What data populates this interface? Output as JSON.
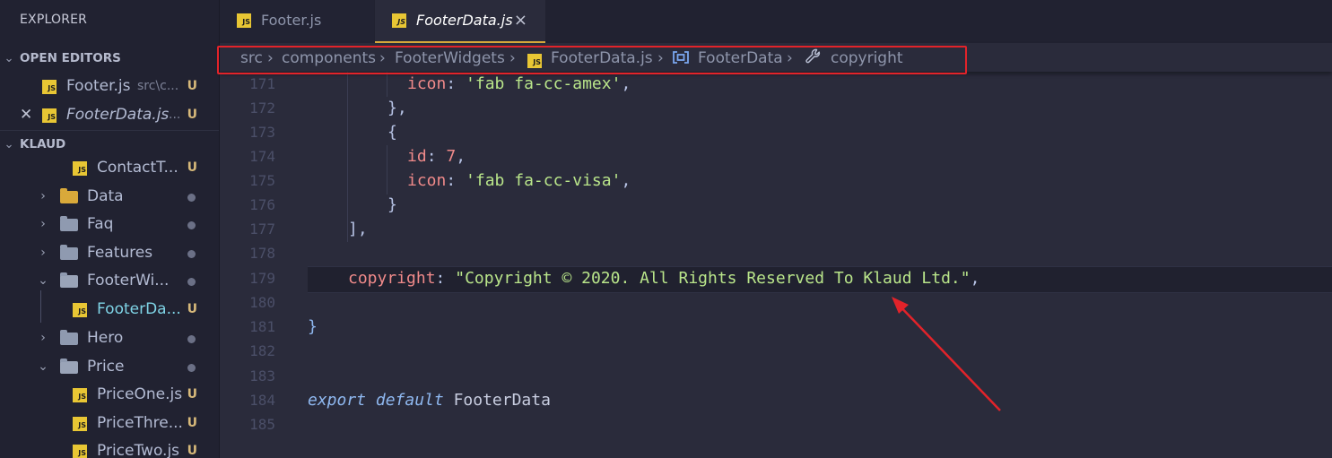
{
  "sidebar": {
    "title": "EXPLORER",
    "open_editors_label": "OPEN EDITORS",
    "open_editors": [
      {
        "icon": "js-file-icon",
        "name": "Footer.js",
        "path": "src\\c...",
        "badge": "U",
        "active": false
      },
      {
        "icon": "js-file-icon",
        "name": "FooterData.js",
        "path": "...",
        "badge": "U",
        "active": true
      }
    ],
    "project_label": "KLAUD",
    "tree": [
      {
        "type": "file",
        "name": "ContactT...",
        "badge": "U"
      },
      {
        "type": "folder",
        "name": "Data",
        "expanded": false
      },
      {
        "type": "folder",
        "name": "Faq",
        "expanded": false
      },
      {
        "type": "folder",
        "name": "Features",
        "expanded": false
      },
      {
        "type": "folder",
        "name": "FooterWi...",
        "expanded": true
      },
      {
        "type": "file",
        "name": "FooterDa...",
        "badge": "U",
        "selected": true
      },
      {
        "type": "folder",
        "name": "Hero",
        "expanded": false
      },
      {
        "type": "folder",
        "name": "Price",
        "expanded": true
      },
      {
        "type": "file",
        "name": "PriceOne.js",
        "badge": "U"
      },
      {
        "type": "file",
        "name": "PriceThre...",
        "badge": "U"
      },
      {
        "type": "file",
        "name": "PriceTwo.js",
        "badge": "U"
      }
    ]
  },
  "tabs": [
    {
      "label": "Footer.js",
      "active": false
    },
    {
      "label": "FooterData.js",
      "active": true,
      "close": "×"
    }
  ],
  "breadcrumb": [
    "src",
    "components",
    "FooterWidgets",
    "FooterData.js",
    "FooterData",
    "copyright"
  ],
  "code": {
    "line_numbers": [
      "171",
      "172",
      "173",
      "174",
      "175",
      "176",
      "177",
      "178",
      "179",
      "180",
      "181",
      "182",
      "183",
      "184",
      "185"
    ],
    "l171_key": "icon",
    "l171_colon": ": ",
    "l171_val": "'fab fa-cc-amex'",
    "l171_end": ",",
    "l172": "},",
    "l173": "{",
    "l174_key": "id",
    "l174_colon": ": ",
    "l174_val": "7",
    "l174_end": ",",
    "l175_key": "icon",
    "l175_colon": ": ",
    "l175_val": "'fab fa-cc-visa'",
    "l175_end": ",",
    "l176": "}",
    "l177": "],",
    "l179_key": "copyright",
    "l179_colon": ": ",
    "l179_val": "\"Copyright © 2020. All Rights Reserved To Klaud Ltd.\"",
    "l179_end": ",",
    "l181": "}",
    "l184_kw1": "export",
    "l184_kw2": "default",
    "l184_name": "FooterData"
  },
  "colors": {
    "annotation": "#e2232a",
    "js_badge": "#e8c634",
    "string": "#b9e58a",
    "property": "#f08a8a"
  }
}
